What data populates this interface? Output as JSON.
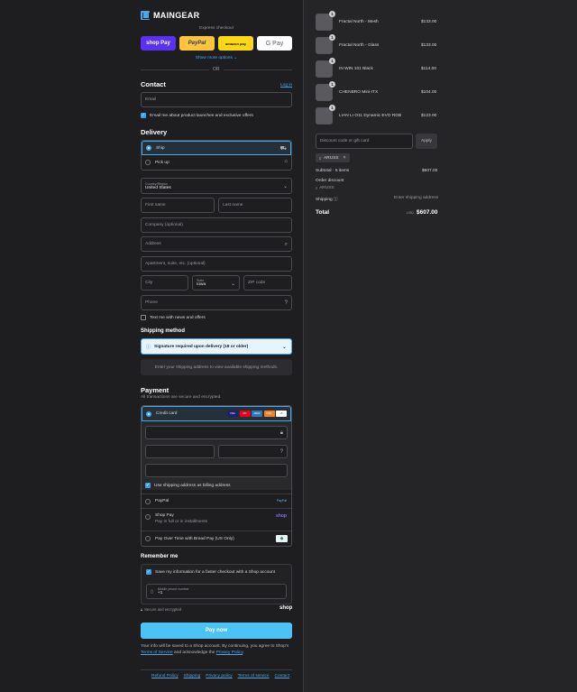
{
  "brand": {
    "name": "MAINGEAR"
  },
  "express": {
    "title": "Express checkout",
    "buttons": [
      {
        "label": "shop Pay",
        "color": "#5a31f4"
      },
      {
        "label": "PayPal",
        "color": "#ffc439"
      },
      {
        "label": "amazon pay",
        "color": "#ffd814"
      },
      {
        "label": "G Pay",
        "color": "#ffffff"
      }
    ],
    "show_more": "Show more options ⌄",
    "or": "OR"
  },
  "contact": {
    "title": "Contact",
    "login": "Log in",
    "email_placeholder": "Email",
    "email_optin": "Email me about product launches and exclusive offers"
  },
  "delivery": {
    "title": "Delivery",
    "ship": "Ship",
    "pickup": "Pick up",
    "country_label": "Country/Region",
    "country_value": "United States",
    "first_name": "First name",
    "last_name": "Last name",
    "company": "Company (optional)",
    "address": "Address",
    "apartment": "Apartment, suite, etc. (optional)",
    "city": "City",
    "state_label": "State",
    "state_value": "Iowa",
    "zip": "ZIP code",
    "phone": "Phone",
    "text_optin": "Text me with news and offers"
  },
  "shipping_method": {
    "title": "Shipping method",
    "notice": "Signature required upon delivery (18 or older)",
    "hint": "Enter your shipping address to view available shipping methods."
  },
  "payment": {
    "title": "Payment",
    "subtitle": "All transactions are secure and encrypted.",
    "credit_card": "Credit card",
    "card_brands": [
      "VISA",
      "MC",
      "AMEX",
      "DISC",
      "+5"
    ],
    "billing_same": "Use shipping address as billing address",
    "paypal": "PayPal",
    "paypal_logo": "PayPal",
    "shop_pay": "Shop Pay",
    "shop_pay_sub": "Pay in full or in installments",
    "shop_logo": "shop",
    "bread": "Pay Over Time with Bread Pay (US Only)"
  },
  "remember": {
    "title": "Remember me",
    "save_info": "Save my information for a faster checkout with a Shop account",
    "mobile_label": "Mobile phone number",
    "mobile_value": "+1",
    "secure": "Secure and encrypted",
    "shop_logo": "shop"
  },
  "pay_now": "Pay now",
  "legal": {
    "text1": "Your info will be saved to a Shop account. By continuing, you agree to Shop’s",
    "terms": "Terms of Service",
    "text2": " and acknowledge the ",
    "privacy": "Privacy Policy",
    "text3": "."
  },
  "footer": [
    "Refund Policy",
    "Shipping",
    "Privacy policy",
    "Terms of service",
    "Contact"
  ],
  "cart": {
    "items": [
      {
        "qty": "1",
        "name": "Fractal North - Mesh",
        "price": "$133.00"
      },
      {
        "qty": "1",
        "name": "Fractal North - Glass",
        "price": "$133.00"
      },
      {
        "qty": "1",
        "name": "IN WIN 101 Black",
        "price": "$114.00"
      },
      {
        "qty": "1",
        "name": "CHENBRO Mini-ITX",
        "price": "$104.00"
      },
      {
        "qty": "1",
        "name": "LIAN LI O11 Dynamic EVO RGB",
        "price": "$123.00"
      }
    ],
    "discount_placeholder": "Discount code or gift card",
    "apply": "Apply",
    "code_tag": "ARUSS",
    "subtotal_label": "Subtotal · 5 items",
    "subtotal_value": "$607.00",
    "order_discount": "Order discount",
    "discount_code": "ARUSS",
    "shipping_label": "Shipping ⓘ",
    "shipping_value": "Enter shipping address",
    "total_label": "Total",
    "currency": "USD",
    "total_value": "$607.00"
  }
}
